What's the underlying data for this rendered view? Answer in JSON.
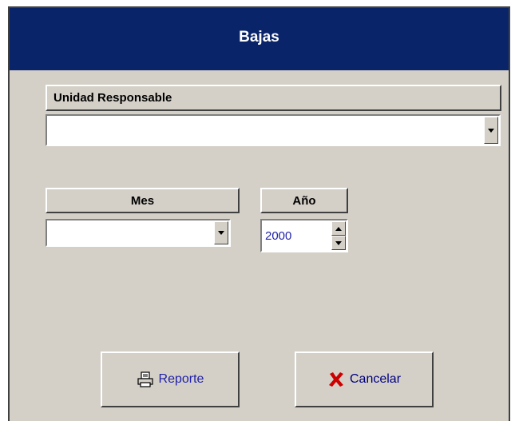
{
  "window": {
    "title": "Bajas"
  },
  "unidad": {
    "header": "Unidad Responsable",
    "value": ""
  },
  "mes": {
    "header": "Mes",
    "value": ""
  },
  "anio": {
    "header": "Año",
    "value": "2000"
  },
  "buttons": {
    "reporte": {
      "label": "Reporte",
      "icon": "printer-icon"
    },
    "cancelar": {
      "label": "Cancelar",
      "icon": "red-x-icon"
    }
  },
  "colors": {
    "titlebar": "#0a246a",
    "face": "#d4d0c8",
    "value_text": "#1f1fa8",
    "cancel_x": "#cc0000"
  }
}
